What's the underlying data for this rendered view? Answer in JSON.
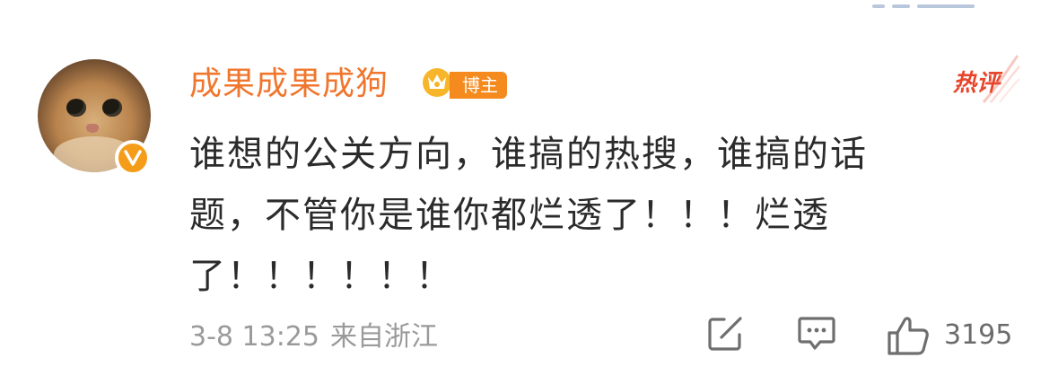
{
  "comment": {
    "user": {
      "name": "成果成果成狗",
      "badge_label": "博主",
      "verified": true
    },
    "hot_label": "热评",
    "content_lines": [
      "谁想的公关方向，谁搞的热搜，谁搞的话",
      "题，不管你是谁你都烂透了！！！烂透",
      "了！！！！！！"
    ],
    "timestamp": "3-8 13:25",
    "source": "来自浙江",
    "actions": {
      "share_icon": "share-icon",
      "comment_icon": "comment-icon",
      "like_icon": "thumbs-up-icon",
      "like_count": "3195"
    }
  },
  "colors": {
    "username": "#f0762e",
    "badge": "#f58a1e",
    "hot": "#e8462c",
    "verified": "#f59d1a",
    "meta": "#9a9a9a"
  }
}
